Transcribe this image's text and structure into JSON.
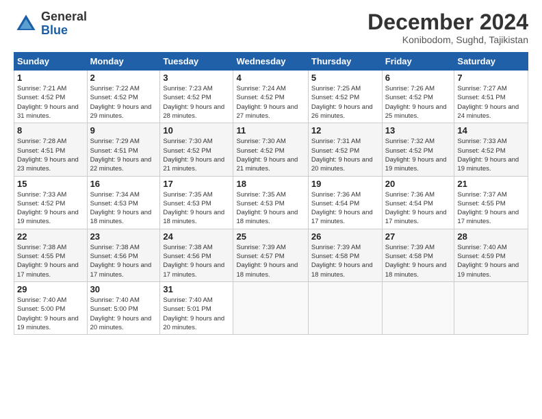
{
  "logo": {
    "line1": "General",
    "line2": "Blue"
  },
  "title": "December 2024",
  "subtitle": "Konibodom, Sughd, Tajikistan",
  "days_of_week": [
    "Sunday",
    "Monday",
    "Tuesday",
    "Wednesday",
    "Thursday",
    "Friday",
    "Saturday"
  ],
  "weeks": [
    [
      {
        "day": "1",
        "sunrise": "7:21 AM",
        "sunset": "4:52 PM",
        "daylight": "9 hours and 31 minutes."
      },
      {
        "day": "2",
        "sunrise": "7:22 AM",
        "sunset": "4:52 PM",
        "daylight": "9 hours and 29 minutes."
      },
      {
        "day": "3",
        "sunrise": "7:23 AM",
        "sunset": "4:52 PM",
        "daylight": "9 hours and 28 minutes."
      },
      {
        "day": "4",
        "sunrise": "7:24 AM",
        "sunset": "4:52 PM",
        "daylight": "9 hours and 27 minutes."
      },
      {
        "day": "5",
        "sunrise": "7:25 AM",
        "sunset": "4:52 PM",
        "daylight": "9 hours and 26 minutes."
      },
      {
        "day": "6",
        "sunrise": "7:26 AM",
        "sunset": "4:52 PM",
        "daylight": "9 hours and 25 minutes."
      },
      {
        "day": "7",
        "sunrise": "7:27 AM",
        "sunset": "4:51 PM",
        "daylight": "9 hours and 24 minutes."
      }
    ],
    [
      {
        "day": "8",
        "sunrise": "7:28 AM",
        "sunset": "4:51 PM",
        "daylight": "9 hours and 23 minutes."
      },
      {
        "day": "9",
        "sunrise": "7:29 AM",
        "sunset": "4:51 PM",
        "daylight": "9 hours and 22 minutes."
      },
      {
        "day": "10",
        "sunrise": "7:30 AM",
        "sunset": "4:52 PM",
        "daylight": "9 hours and 21 minutes."
      },
      {
        "day": "11",
        "sunrise": "7:30 AM",
        "sunset": "4:52 PM",
        "daylight": "9 hours and 21 minutes."
      },
      {
        "day": "12",
        "sunrise": "7:31 AM",
        "sunset": "4:52 PM",
        "daylight": "9 hours and 20 minutes."
      },
      {
        "day": "13",
        "sunrise": "7:32 AM",
        "sunset": "4:52 PM",
        "daylight": "9 hours and 19 minutes."
      },
      {
        "day": "14",
        "sunrise": "7:33 AM",
        "sunset": "4:52 PM",
        "daylight": "9 hours and 19 minutes."
      }
    ],
    [
      {
        "day": "15",
        "sunrise": "7:33 AM",
        "sunset": "4:52 PM",
        "daylight": "9 hours and 19 minutes."
      },
      {
        "day": "16",
        "sunrise": "7:34 AM",
        "sunset": "4:53 PM",
        "daylight": "9 hours and 18 minutes."
      },
      {
        "day": "17",
        "sunrise": "7:35 AM",
        "sunset": "4:53 PM",
        "daylight": "9 hours and 18 minutes."
      },
      {
        "day": "18",
        "sunrise": "7:35 AM",
        "sunset": "4:53 PM",
        "daylight": "9 hours and 18 minutes."
      },
      {
        "day": "19",
        "sunrise": "7:36 AM",
        "sunset": "4:54 PM",
        "daylight": "9 hours and 17 minutes."
      },
      {
        "day": "20",
        "sunrise": "7:36 AM",
        "sunset": "4:54 PM",
        "daylight": "9 hours and 17 minutes."
      },
      {
        "day": "21",
        "sunrise": "7:37 AM",
        "sunset": "4:55 PM",
        "daylight": "9 hours and 17 minutes."
      }
    ],
    [
      {
        "day": "22",
        "sunrise": "7:38 AM",
        "sunset": "4:55 PM",
        "daylight": "9 hours and 17 minutes."
      },
      {
        "day": "23",
        "sunrise": "7:38 AM",
        "sunset": "4:56 PM",
        "daylight": "9 hours and 17 minutes."
      },
      {
        "day": "24",
        "sunrise": "7:38 AM",
        "sunset": "4:56 PM",
        "daylight": "9 hours and 17 minutes."
      },
      {
        "day": "25",
        "sunrise": "7:39 AM",
        "sunset": "4:57 PM",
        "daylight": "9 hours and 18 minutes."
      },
      {
        "day": "26",
        "sunrise": "7:39 AM",
        "sunset": "4:58 PM",
        "daylight": "9 hours and 18 minutes."
      },
      {
        "day": "27",
        "sunrise": "7:39 AM",
        "sunset": "4:58 PM",
        "daylight": "9 hours and 18 minutes."
      },
      {
        "day": "28",
        "sunrise": "7:40 AM",
        "sunset": "4:59 PM",
        "daylight": "9 hours and 19 minutes."
      }
    ],
    [
      {
        "day": "29",
        "sunrise": "7:40 AM",
        "sunset": "5:00 PM",
        "daylight": "9 hours and 19 minutes."
      },
      {
        "day": "30",
        "sunrise": "7:40 AM",
        "sunset": "5:00 PM",
        "daylight": "9 hours and 20 minutes."
      },
      {
        "day": "31",
        "sunrise": "7:40 AM",
        "sunset": "5:01 PM",
        "daylight": "9 hours and 20 minutes."
      },
      null,
      null,
      null,
      null
    ]
  ]
}
